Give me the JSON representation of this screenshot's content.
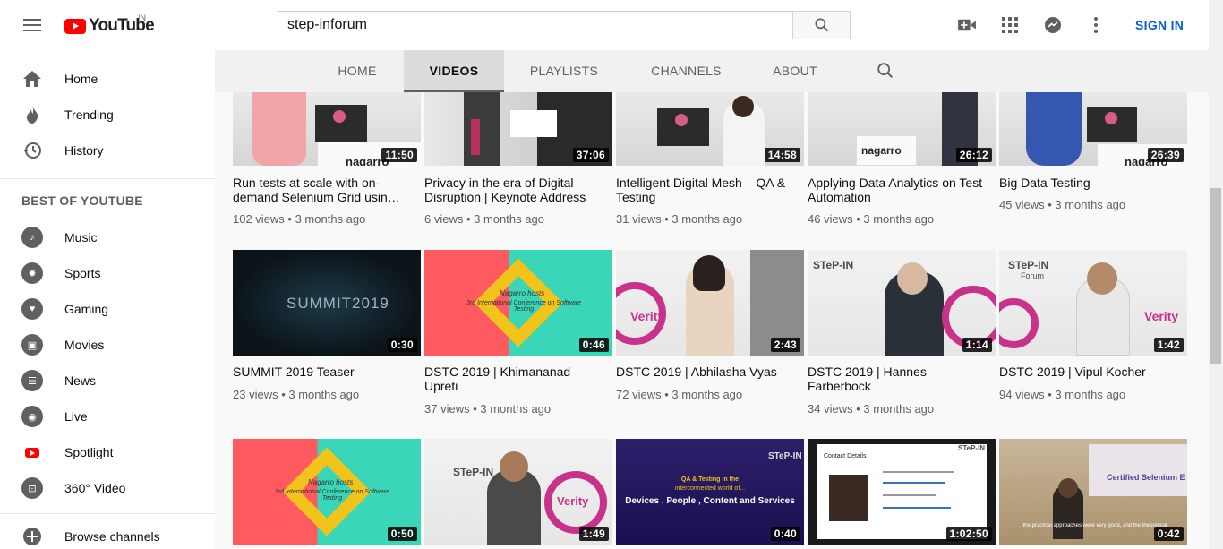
{
  "header": {
    "logo_text": "YouTube",
    "country": "IN",
    "search_value": "step-inforum",
    "search_placeholder": "Search",
    "sign_in": "SIGN IN"
  },
  "sidebar": {
    "main": [
      {
        "label": "Home",
        "icon": "home-icon"
      },
      {
        "label": "Trending",
        "icon": "trending-icon"
      },
      {
        "label": "History",
        "icon": "history-icon"
      }
    ],
    "section_title": "BEST OF YOUTUBE",
    "best": [
      {
        "label": "Music",
        "icon": "music-icon"
      },
      {
        "label": "Sports",
        "icon": "sports-icon"
      },
      {
        "label": "Gaming",
        "icon": "gaming-icon"
      },
      {
        "label": "Movies",
        "icon": "movies-icon"
      },
      {
        "label": "News",
        "icon": "news-icon"
      },
      {
        "label": "Live",
        "icon": "live-icon"
      },
      {
        "label": "Spotlight",
        "icon": "spotlight-icon"
      },
      {
        "label": "360° Video",
        "icon": "360-video-icon"
      }
    ],
    "browse": "Browse channels"
  },
  "tabs": [
    "HOME",
    "VIDEOS",
    "PLAYLISTS",
    "CHANNELS",
    "ABOUT"
  ],
  "active_tab": "VIDEOS",
  "videos": [
    {
      "title": "Run tests at scale with on-demand Selenium Grid usin…",
      "views": "102 views",
      "age": "3 months ago",
      "duration": "11:50"
    },
    {
      "title": "Privacy in the era of Digital Disruption | Keynote Address",
      "views": "6 views",
      "age": "3 months ago",
      "duration": "37:06"
    },
    {
      "title": "Intelligent Digital Mesh – QA & Testing",
      "views": "31 views",
      "age": "3 months ago",
      "duration": "14:58"
    },
    {
      "title": "Applying Data Analytics on Test Automation",
      "views": "46 views",
      "age": "3 months ago",
      "duration": "26:12"
    },
    {
      "title": "Big Data Testing",
      "views": "45 views",
      "age": "3 months ago",
      "duration": "26:39"
    },
    {
      "title": "SUMMIT 2019 Teaser",
      "views": "23 views",
      "age": "3 months ago",
      "duration": "0:30"
    },
    {
      "title": "DSTC 2019 | Khimananad Upreti",
      "views": "37 views",
      "age": "3 months ago",
      "duration": "0:46"
    },
    {
      "title": "DSTC 2019 | Abhilasha Vyas",
      "views": "72 views",
      "age": "3 months ago",
      "duration": "2:43"
    },
    {
      "title": "DSTC 2019 | Hannes Farberbock",
      "views": "34 views",
      "age": "3 months ago",
      "duration": "1:14"
    },
    {
      "title": "DSTC 2019 | Vipul Kocher",
      "views": "94 views",
      "age": "3 months ago",
      "duration": "1:42"
    },
    {
      "duration": "0:50"
    },
    {
      "duration": "1:49"
    },
    {
      "duration": "0:40"
    },
    {
      "duration": "1:02:50"
    },
    {
      "duration": "0:42"
    }
  ],
  "thumb_text": {
    "nagarro": "nagarro",
    "summit": "SUMMIT2019",
    "conference_host": "Nagarro hosts",
    "conference": "3rd International Conference on Software Testing",
    "verity": "Verity",
    "step_in": "STeP-IN",
    "forum": "Forum",
    "qa_line1": "QA & Testing in the",
    "qa_line2": "interconnected world of...",
    "qa_line3": "Devices , People , Content and Services",
    "contact": "Contact Details",
    "certified": "Certified Selenium E",
    "practical": "the practical approaches were very good, and the theoretical"
  },
  "colors": {
    "youtube_red": "#ff0000",
    "sign_in_blue": "#065fd4",
    "duration_bg": "#000000"
  }
}
